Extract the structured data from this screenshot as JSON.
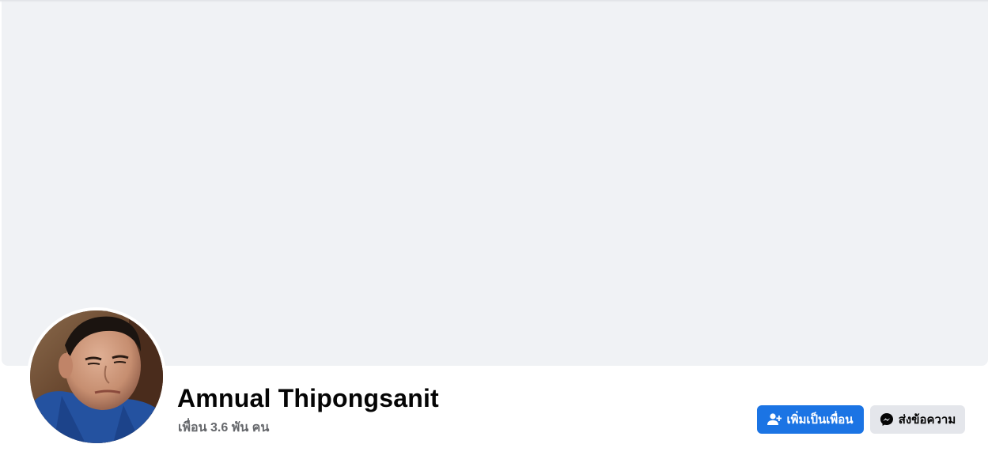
{
  "profile": {
    "name": "Amnual Thipongsanit",
    "friends_text": "เพื่อน 3.6 พัน คน"
  },
  "actions": {
    "add_friend_label": "เพิ่มเป็นเพื่อน",
    "add_friend_icon": "add-friend-icon",
    "message_label": "ส่งข้อความ",
    "message_icon": "messenger-icon"
  },
  "colors": {
    "cover": "#f0f2f5",
    "primary_button": "#1b74e4",
    "secondary_button": "#e4e6eb",
    "name_text": "#050505",
    "secondary_text": "#65676b"
  }
}
